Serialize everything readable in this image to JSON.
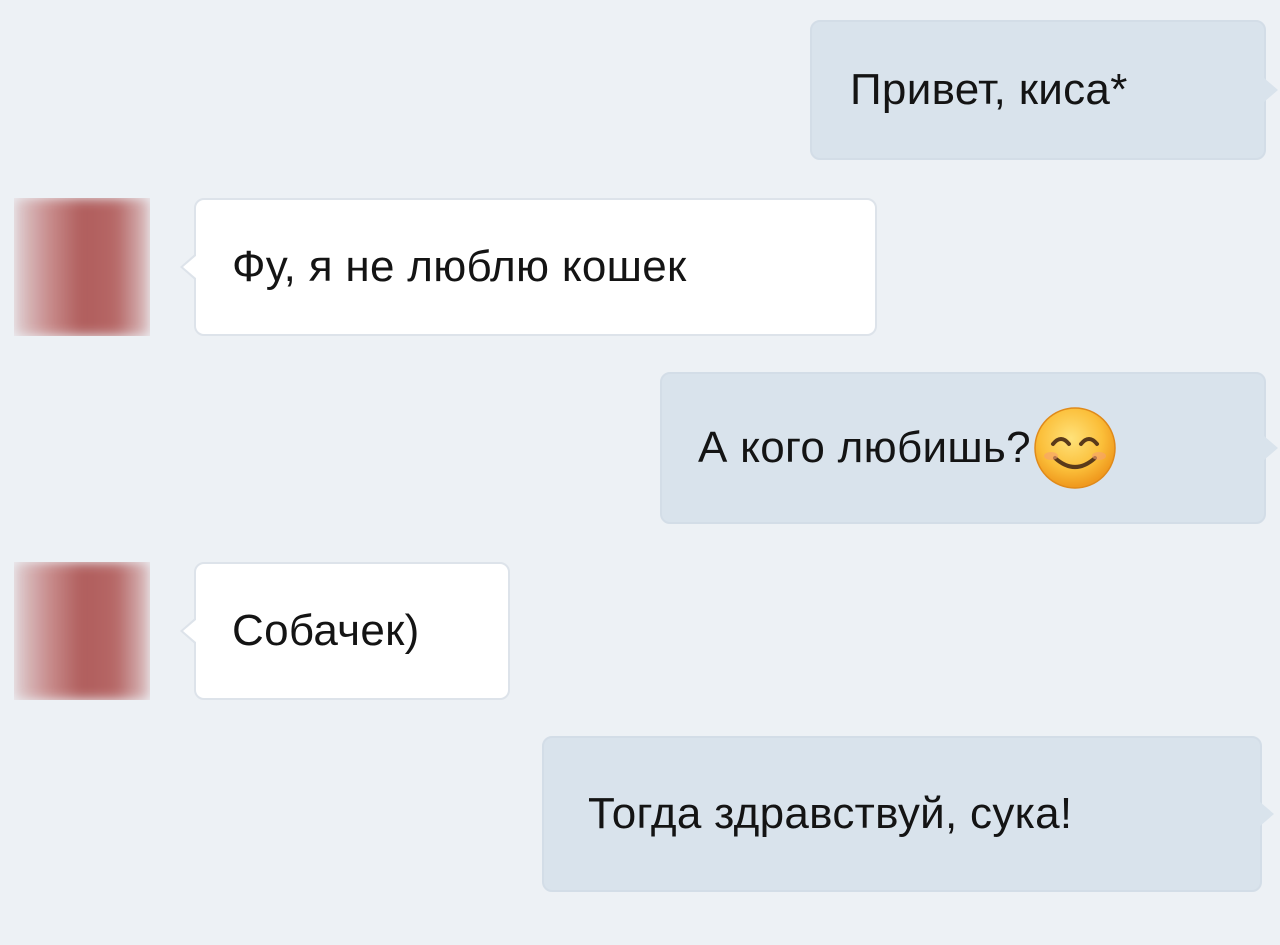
{
  "conversation": {
    "messages": [
      {
        "direction": "outgoing",
        "text": "Привет, киса*"
      },
      {
        "direction": "incoming",
        "text": "Фу, я не люблю кошек"
      },
      {
        "direction": "outgoing",
        "text": "А кого любишь?",
        "emoji": "smiling-face-with-smiling-eyes"
      },
      {
        "direction": "incoming",
        "text": "Собачек)"
      },
      {
        "direction": "outgoing",
        "text": "Тогда здравствуй, сука!"
      }
    ]
  },
  "colors": {
    "background": "#edf1f5",
    "outgoing_bubble": "#d9e3ec",
    "incoming_bubble": "#ffffff",
    "text": "#141414",
    "emoji_face": "#f9b233"
  }
}
